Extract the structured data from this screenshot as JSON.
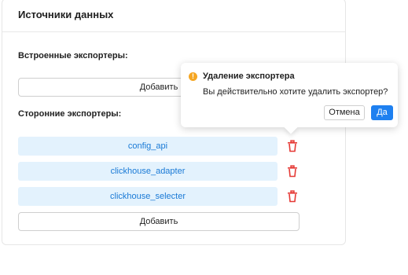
{
  "panel": {
    "title": "Источники данных"
  },
  "builtin": {
    "label": "Встроенные экспортеры:",
    "add_label": "Добавить"
  },
  "third_party": {
    "label": "Сторонние экспортеры:",
    "items": [
      {
        "name": "config_api",
        "delete_icon": "trash-icon"
      },
      {
        "name": "clickhouse_adapter",
        "delete_icon": "trash-icon"
      },
      {
        "name": "clickhouse_selecter",
        "delete_icon": "trash-icon"
      }
    ],
    "add_label": "Добавить"
  },
  "confirm_popover": {
    "icon": "warning-icon",
    "title": "Удаление экспортера",
    "message": "Вы действительно хотите удалить экспортер?",
    "cancel_label": "Отмена",
    "confirm_label": "Да"
  },
  "colors": {
    "accent": "#1e80f0",
    "chip_background": "#e3f2fd",
    "chip_text": "#1a7ad6",
    "delete_icon": "#e53935",
    "warning": "#f5a623"
  }
}
